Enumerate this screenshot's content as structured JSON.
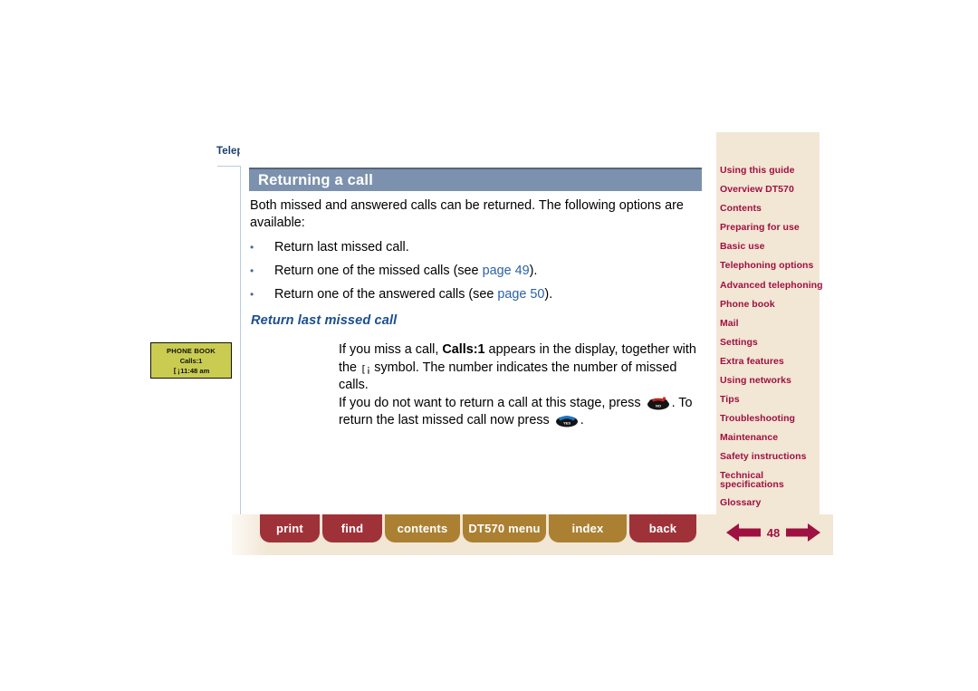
{
  "document": {
    "breadcrumb": "Telephoning options",
    "page_number": "48"
  },
  "section": {
    "title": "Returning a call",
    "intro": "Both missed and answered calls can be returned. The following options are available:",
    "bullets": [
      {
        "text_before": "Return last missed call.",
        "link": "",
        "text_after": ""
      },
      {
        "text_before": "Return one of the missed calls (see ",
        "link": "page 49",
        "text_after": ")."
      },
      {
        "text_before": "Return one of the answered calls (see ",
        "link": "page 50",
        "text_after": ")."
      }
    ],
    "subheading": "Return last missed call",
    "body": {
      "p1_a": "If you miss a call, ",
      "p1_bold": "Calls:1",
      "p1_b": " appears in the display, together with the ",
      "p1_c": " symbol. The number indicates the number of missed calls.",
      "p2_a": "If you do not want to return a call at this stage, press ",
      "p2_b": ". To return the last missed call now press ",
      "p2_c": "."
    }
  },
  "lcd_figure": {
    "line1": "PHONE BOOK",
    "line2": "Calls:1",
    "line3": "11:48 am"
  },
  "keys": {
    "no_label": "NO",
    "yes_label": "YES"
  },
  "sidebar": {
    "items": [
      {
        "label": "Using this guide"
      },
      {
        "label": "Overview DT570"
      },
      {
        "label": "Contents"
      },
      {
        "label": "Preparing for use"
      },
      {
        "label": "Basic use"
      },
      {
        "label": "Telephoning options"
      },
      {
        "label": "Advanced telephoning"
      },
      {
        "label": "Phone book"
      },
      {
        "label": "Mail"
      },
      {
        "label": "Settings"
      },
      {
        "label": "Extra features"
      },
      {
        "label": "Using networks"
      },
      {
        "label": "Tips"
      },
      {
        "label": "Troubleshooting"
      },
      {
        "label": "Maintenance"
      },
      {
        "label": "Safety instructions"
      },
      {
        "label": "Technical specifications"
      },
      {
        "label": "Glossary"
      }
    ]
  },
  "toolbar": {
    "buttons": [
      {
        "label": "print",
        "style": "red"
      },
      {
        "label": "find",
        "style": "red"
      },
      {
        "label": "contents",
        "style": "gold"
      },
      {
        "label": "DT570 menu",
        "style": "gold"
      },
      {
        "label": "index",
        "style": "gold"
      },
      {
        "label": "back",
        "style": "red"
      }
    ]
  },
  "colors": {
    "title_bar": "#7c91ad",
    "sidebar_bg": "#f2e6d5",
    "sidebar_text": "#9e1140",
    "link": "#2b62a8",
    "subheading": "#1c4f8f",
    "btn_red": "#9e3238",
    "btn_gold": "#ab8032",
    "lcd_bg": "#c9cc50"
  }
}
